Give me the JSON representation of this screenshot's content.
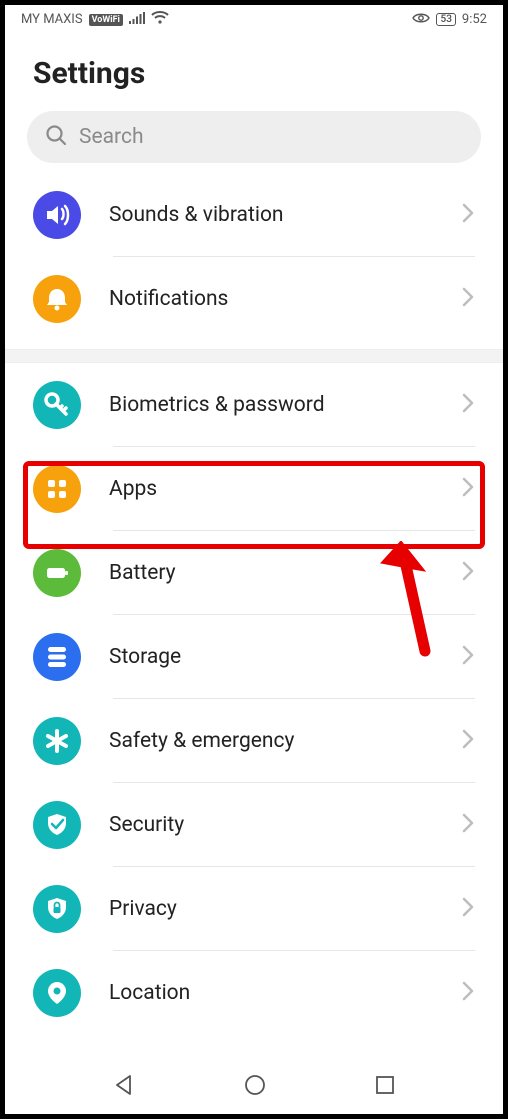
{
  "status_bar": {
    "carrier": "MY MAXIS",
    "vowifi_badge": "VoWiFi",
    "battery_pct": "53",
    "time": "9:52"
  },
  "title": "Settings",
  "search_placeholder": "Search",
  "groups": [
    {
      "items": [
        {
          "id": "sounds",
          "label": "Sounds & vibration",
          "icon": "speaker-icon",
          "color": "c-purple"
        },
        {
          "id": "notifications",
          "label": "Notifications",
          "icon": "bell-icon",
          "color": "c-orange"
        }
      ]
    },
    {
      "items": [
        {
          "id": "biometrics",
          "label": "Biometrics & password",
          "icon": "key-icon",
          "color": "c-teal",
          "highlighted": false
        },
        {
          "id": "apps",
          "label": "Apps",
          "icon": "apps-icon",
          "color": "c-orange",
          "highlighted": true
        },
        {
          "id": "battery",
          "label": "Battery",
          "icon": "battery-icon",
          "color": "c-green"
        },
        {
          "id": "storage",
          "label": "Storage",
          "icon": "storage-icon",
          "color": "c-blue"
        },
        {
          "id": "safety",
          "label": "Safety & emergency",
          "icon": "asterisk-icon",
          "color": "c-teal"
        },
        {
          "id": "security",
          "label": "Security",
          "icon": "shield-icon",
          "color": "c-teal"
        },
        {
          "id": "privacy",
          "label": "Privacy",
          "icon": "lock-icon",
          "color": "c-teal"
        },
        {
          "id": "location",
          "label": "Location",
          "icon": "pin-icon",
          "color": "c-teal"
        }
      ]
    }
  ]
}
